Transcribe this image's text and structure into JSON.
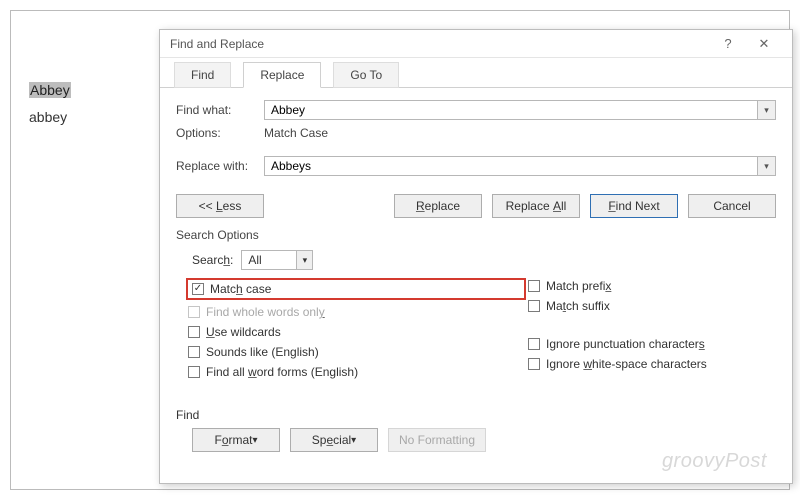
{
  "doc": {
    "selected": "Abbey",
    "line2": "abbey"
  },
  "dialog": {
    "title": "Find and Replace",
    "tabs": {
      "find": "Find",
      "replace": "Replace",
      "goto": "Go To"
    },
    "findwhat_label": "Find what:",
    "findwhat_value": "Abbey",
    "options_label": "Options:",
    "options_value": "Match Case",
    "replacewith_label": "Replace with:",
    "replacewith_value": "Abbeys",
    "buttons": {
      "less": "<< Less",
      "replace": "Replace",
      "replaceall": "Replace All",
      "findnext": "Find Next",
      "cancel": "Cancel"
    },
    "search_options_label": "Search Options",
    "search_label": "Search:",
    "search_value": "All",
    "checks": {
      "match_case": "Match case",
      "whole_words": "Find whole words only",
      "wildcards": "Use wildcards",
      "sounds_like": "Sounds like (English)",
      "all_forms": "Find all word forms (English)",
      "match_prefix": "Match prefix",
      "match_suffix": "Match suffix",
      "ignore_punct": "Ignore punctuation characters",
      "ignore_ws": "Ignore white-space characters"
    },
    "find_section": "Find",
    "format_btn": "Format",
    "special_btn": "Special",
    "noformat_btn": "No Formatting"
  },
  "watermark": "groovyPost"
}
